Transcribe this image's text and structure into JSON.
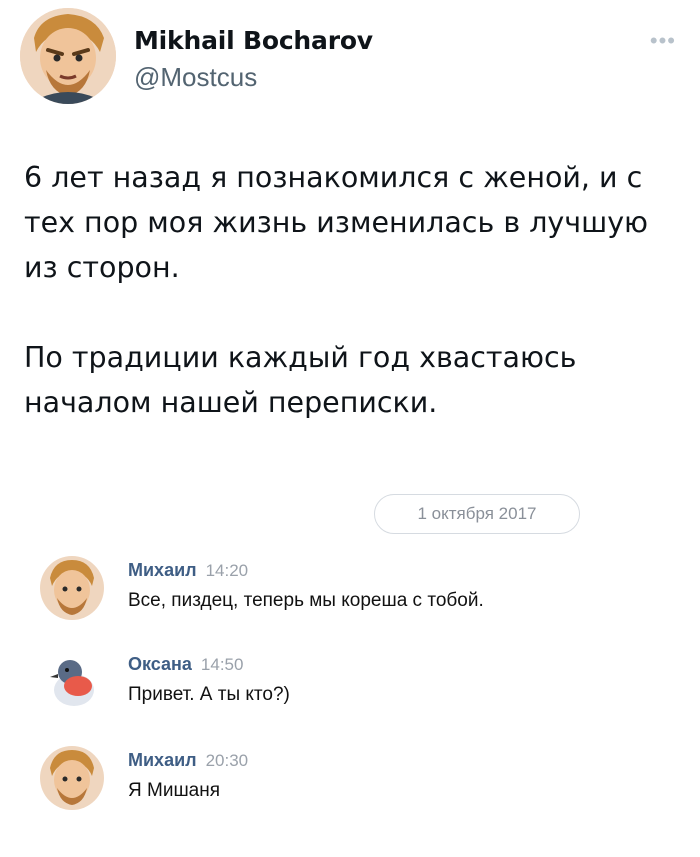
{
  "tweet": {
    "author_name": "Mikhail Bocharov",
    "author_handle": "@Mostcus",
    "more_icon": "more-dots-icon",
    "paragraphs": [
      "6 лет назад я познакомился с женой, и с тех пор моя жизнь изменилась в лучшую из сторон.",
      "По традиции каждый год хвастаюсь началом нашей переписки."
    ]
  },
  "chat": {
    "date": "1 октября 2017",
    "messages": [
      {
        "sender": "Михаил",
        "time": "14:20",
        "text": "Все, пиздец, теперь мы кореша с тобой."
      },
      {
        "sender": "Оксана",
        "time": "14:50",
        "text": "Привет. А ты кто?)"
      },
      {
        "sender": "Михаил",
        "time": "20:30",
        "text": "Я Мишаня"
      }
    ]
  },
  "colors": {
    "name_text": "#0f1419",
    "handle_text": "#536471",
    "chat_sender": "#3f5e85",
    "chat_time": "#9aa1aa"
  }
}
